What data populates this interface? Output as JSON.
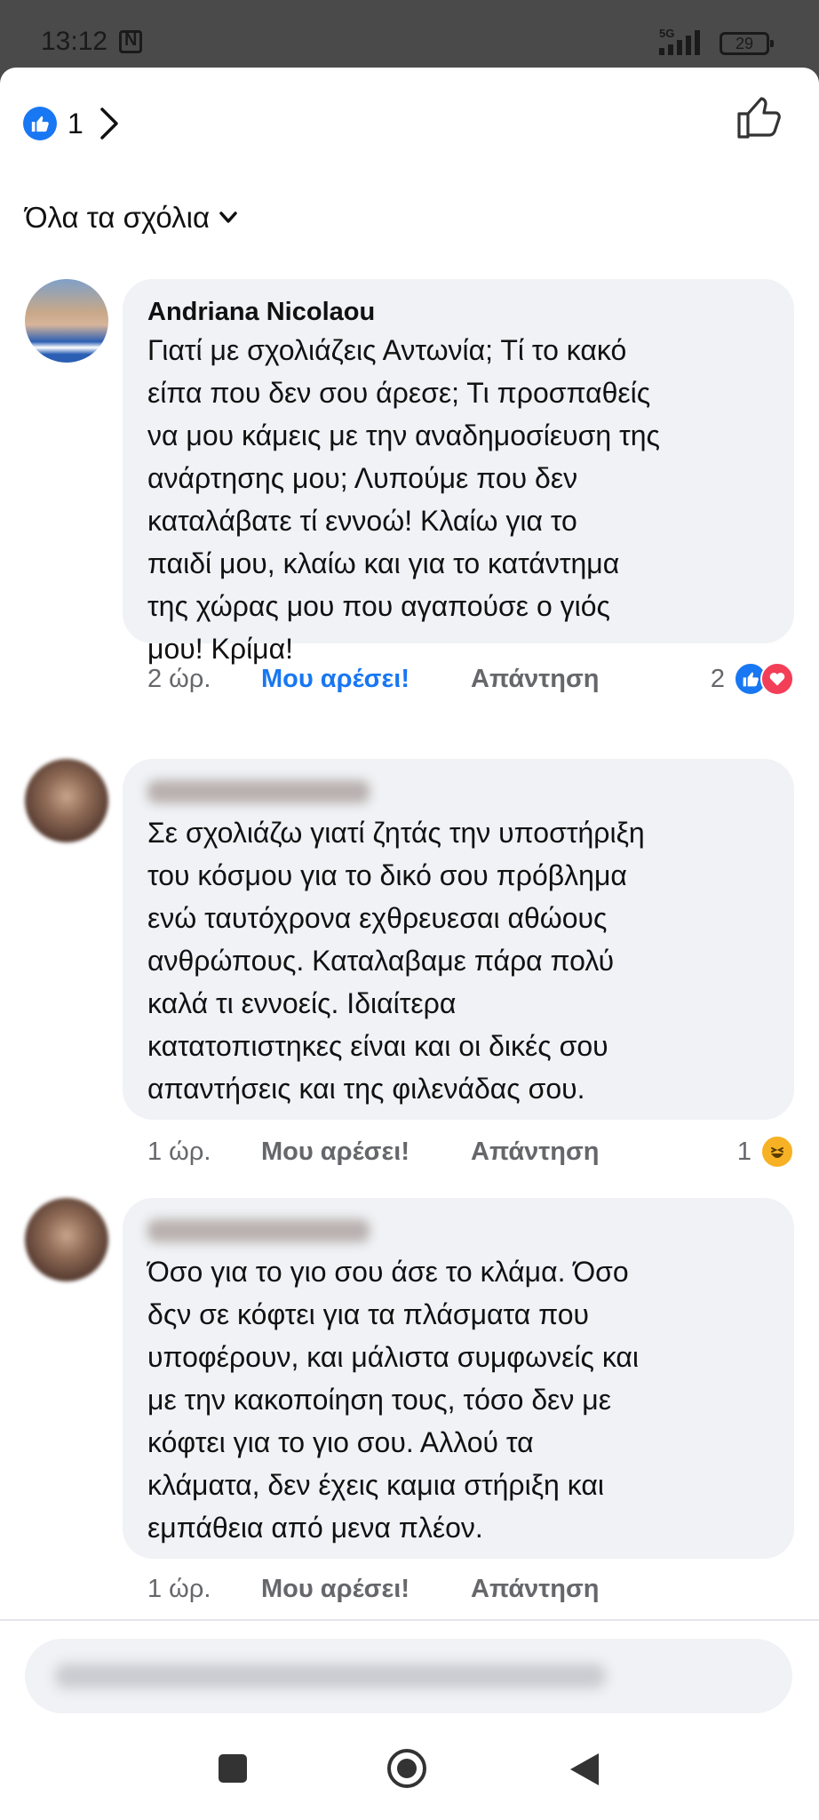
{
  "status_bar": {
    "time": "13:12",
    "network": "5G",
    "battery": "29"
  },
  "header": {
    "reaction_count": "1"
  },
  "filter": {
    "label": "Όλα τα σχόλια"
  },
  "comments": [
    {
      "author": "Andriana Nicolaou",
      "text": "Γιατί με σχολιάζεις Αντωνία;  Τί το κακό\nείπα που δεν σου άρεσε;  Τι προσπαθείς\nνα μου κάμεις με την αναδημοσίευση της\nανάρτησης μου;  Λυπούμε που δεν\nκαταλάβατε τί εννοώ!  Κλαίω για το\nπαιδί μου, κλαίω και για το κατάντημα\nτης χώρας μου που αγαπούσε ο γιός\nμου!  Κρίμα!",
      "time": "2 ώρ.",
      "like_label": "Μου αρέσει!",
      "reply_label": "Απάντηση",
      "reaction_count": "2"
    },
    {
      "text": "Σε σχολιάζω γιατί ζητάς την υποστήριξη\nτου κόσμου για το δικό σου πρόβλημα\nενώ ταυτόχρονα εχθρευεσαι αθώους\nανθρώπους. Καταλαβαμε πάρα πολύ\nκαλά τι εννοείς. Ιδιαίτερα\nκατατοπιστηκες είναι και οι δικές σου\nαπαντήσεις και της φιλενάδας σου.",
      "time": "1 ώρ.",
      "like_label": "Μου αρέσει!",
      "reply_label": "Απάντηση",
      "reaction_count": "1"
    },
    {
      "text": "Όσο για το γιο σου άσε το κλάμα. Όσο\nδςν σε κόφτει για τα πλάσματα που\nυποφέρουν, και μάλιστα συμφωνείς και\nμε την κακοποίηση τους, τόσο δεν με\nκόφτει για το γιο σου. Αλλού τα\nκλάματα, δεν έχεις καμια στήριξη και\nεμπάθεια από μενα πλέον.",
      "time": "1 ώρ.",
      "like_label": "Μου αρέσει!",
      "reply_label": "Απάντηση"
    }
  ],
  "colors": {
    "accent": "#1877f2",
    "bubble": "#f0f2f5",
    "meta": "#65676b",
    "love": "#f33e58",
    "haha": "#f7b125"
  },
  "icons": [
    "like-reaction-icon",
    "chevron-right-icon",
    "thumbs-up-outline-icon",
    "chevron-down-icon",
    "love-reaction-icon",
    "haha-reaction-icon",
    "square-nav-icon",
    "home-circle-nav-icon",
    "back-triangle-nav-icon"
  ]
}
